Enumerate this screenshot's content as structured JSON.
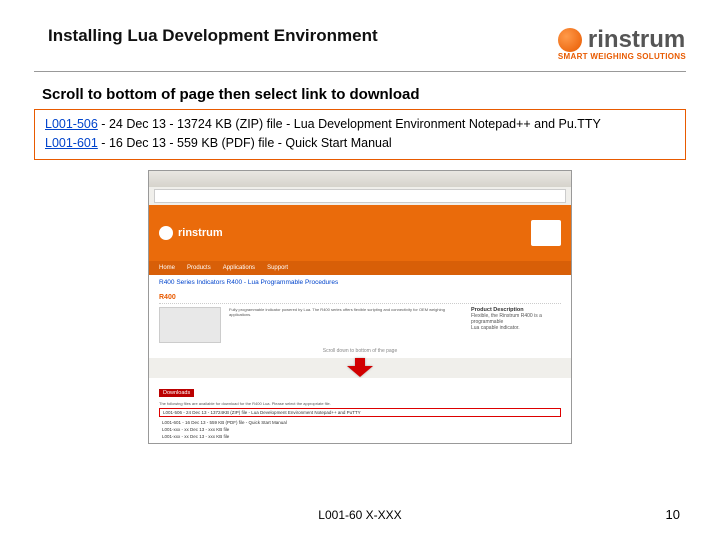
{
  "title": "Installing Lua Development Environment",
  "brand": {
    "name": "rinstrum",
    "tagline": "SMART WEIGHING SOLUTIONS"
  },
  "subtitle": "Scroll to bottom of page then select link to download",
  "rows": [
    {
      "code": "L001-506",
      "date": "24 Dec 13",
      "size": "13724 KB (ZIP) file",
      "desc": "Lua Development Environment Notepad++ and Pu.TTY"
    },
    {
      "code": "L001-601",
      "date": "16 Dec 13",
      "size": "559 KB (PDF) file",
      "desc": "Quick Start Manual"
    }
  ],
  "shot": {
    "breadcrumb": "R400 Series Indicators   R400 - Lua Programmable Procedures",
    "main_heading": "R400",
    "side_heading": "Product Description",
    "dl_heading": "Downloads",
    "highlighted": "L001-506 - 24 Dec 13 - 13724KB (ZIP) file - Lua Development Environment Notepad++ and PuTTY",
    "line2": "L001-601 - 16 Dec 13 - 559 KB (PDF) file - Quick Start Manual"
  },
  "footer_code": "L001-60 X-XXX",
  "page_num": "10"
}
